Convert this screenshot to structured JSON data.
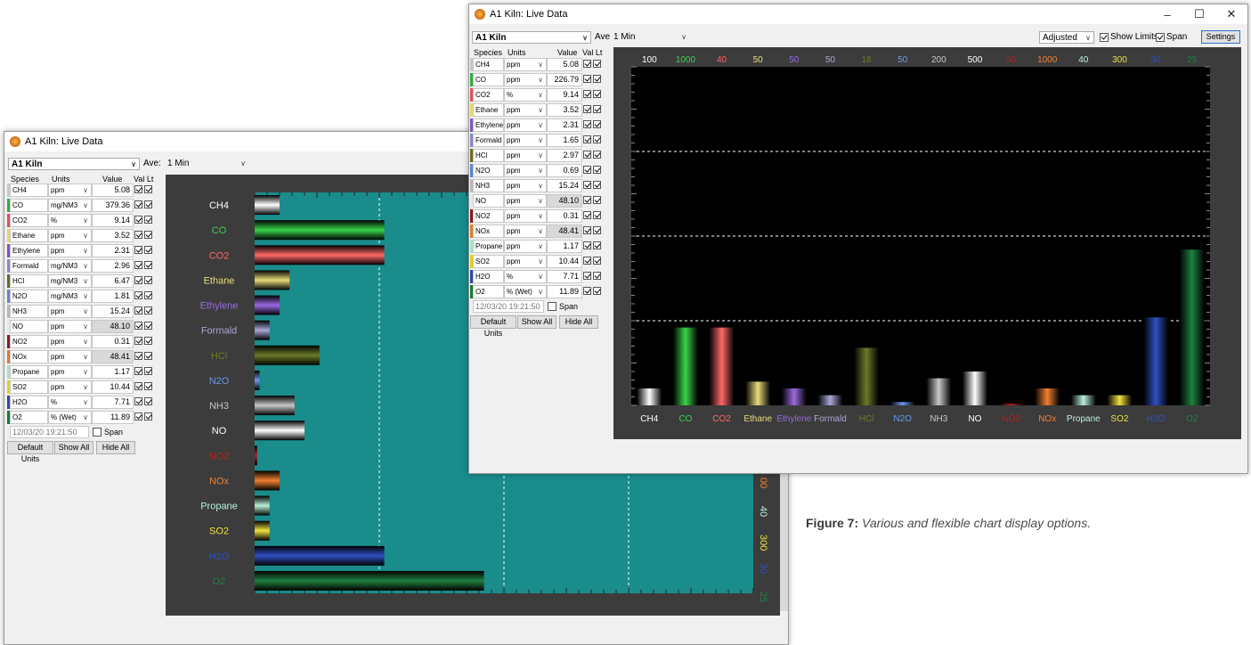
{
  "caption": {
    "label": "Figure 7:",
    "text": " Various and flexible chart display options."
  },
  "window_left": {
    "title": "A1 Kiln: Live Data",
    "kiln_select": "A1 Kiln",
    "ave_label": "Ave:",
    "ave_select": "1 Min",
    "headers": {
      "species": "Species",
      "units": "Units",
      "value": "Value",
      "val_lt": "Val Lt"
    },
    "rows": [
      {
        "name": "CH4",
        "unit": "ppm",
        "value": "5.08",
        "color": "#c8c8c8",
        "grey": false
      },
      {
        "name": "CO",
        "unit": "mg/NM3",
        "value": "379.36",
        "color": "#2fae3a",
        "grey": false
      },
      {
        "name": "CO2",
        "unit": "%",
        "value": "9.14",
        "color": "#e0505a",
        "grey": false
      },
      {
        "name": "Ethane",
        "unit": "ppm",
        "value": "3.52",
        "color": "#e6d86a",
        "grey": false
      },
      {
        "name": "Ethylene",
        "unit": "ppm",
        "value": "2.31",
        "color": "#7a55c0",
        "grey": false
      },
      {
        "name": "Formald",
        "unit": "mg/NM3",
        "value": "2.96",
        "color": "#8a88c8",
        "grey": false
      },
      {
        "name": "HCl",
        "unit": "mg/NM3",
        "value": "6.47",
        "color": "#6a6a20",
        "grey": false
      },
      {
        "name": "N2O",
        "unit": "mg/NM3",
        "value": "1.81",
        "color": "#5a86d0",
        "grey": false
      },
      {
        "name": "NH3",
        "unit": "ppm",
        "value": "15.24",
        "color": "#b8b8b8",
        "grey": false
      },
      {
        "name": "NO",
        "unit": "ppm",
        "value": "48.10",
        "color": "#e8e8e8",
        "grey": true
      },
      {
        "name": "NO2",
        "unit": "ppm",
        "value": "0.31",
        "color": "#8a1a1a",
        "grey": false
      },
      {
        "name": "NOx",
        "unit": "ppm",
        "value": "48.41",
        "color": "#e07a28",
        "grey": true
      },
      {
        "name": "Propane",
        "unit": "ppm",
        "value": "1.17",
        "color": "#a8e0c8",
        "grey": false
      },
      {
        "name": "SO2",
        "unit": "ppm",
        "value": "10.44",
        "color": "#e0d020",
        "grey": false
      },
      {
        "name": "H2O",
        "unit": "%",
        "value": "7.71",
        "color": "#2a4aa0",
        "grey": false
      },
      {
        "name": "O2",
        "unit": "% (Wet)",
        "value": "11.89",
        "color": "#1a7a30",
        "grey": false
      }
    ],
    "timestamp": "12/03/20 19:21:50",
    "span_label": "Span",
    "buttons": {
      "default_units": "Default Units",
      "show_all": "Show All",
      "hide_all": "Hide All"
    },
    "chart_data": {
      "type": "bar",
      "orientation": "horizontal",
      "background": "#1a8c8c",
      "categories": [
        "CH4",
        "CO",
        "CO2",
        "Ethane",
        "Ethylene",
        "Formald",
        "HCl",
        "N2O",
        "NH3",
        "NO",
        "NO2",
        "NOx",
        "Propane",
        "SO2",
        "H2O",
        "O2"
      ],
      "category_colors": [
        "#ffffff",
        "#3ad44a",
        "#ff6868",
        "#e8dc7a",
        "#9a6ae0",
        "#a8a8d8",
        "#6a7a28",
        "#6a9ae8",
        "#c8c8c8",
        "#ffffff",
        "#b82020",
        "#f08030",
        "#b8f0d8",
        "#f0e040",
        "#3050c0",
        "#208040"
      ],
      "values_percent_of_scale": [
        5,
        26,
        26,
        7,
        5,
        3,
        13,
        1,
        8,
        10,
        0.5,
        5,
        3,
        3,
        26,
        46
      ],
      "right_scale_labels_visible": [
        "00",
        "40",
        "300",
        "30",
        "25"
      ],
      "right_scale_colors": [
        "#f08030",
        "#b8f0d8",
        "#f0e040",
        "#3050c0",
        "#208040"
      ]
    }
  },
  "window_right": {
    "title": "A1 Kiln: Live Data",
    "kiln_select": "A1 Kiln",
    "ave_label": "Ave:",
    "ave_select": "1 Min",
    "adjusted_select": "Adjusted",
    "show_limits_label": "Show Limits",
    "span_label": "Span",
    "settings_label": "Settings",
    "win_min": "–",
    "win_max": "☐",
    "win_close": "✕",
    "headers": {
      "species": "Species",
      "units": "Units",
      "value": "Value",
      "val_lt": "Val Lt"
    },
    "rows": [
      {
        "name": "CH4",
        "unit": "ppm",
        "value": "5.08",
        "color": "#c8c8c8",
        "grey": false
      },
      {
        "name": "CO",
        "unit": "ppm",
        "value": "226.79",
        "color": "#2fae3a",
        "grey": false
      },
      {
        "name": "CO2",
        "unit": "%",
        "value": "9.14",
        "color": "#e0505a",
        "grey": false
      },
      {
        "name": "Ethane",
        "unit": "ppm",
        "value": "3.52",
        "color": "#e6d86a",
        "grey": false
      },
      {
        "name": "Ethylene",
        "unit": "ppm",
        "value": "2.31",
        "color": "#7a55c0",
        "grey": false
      },
      {
        "name": "Formald",
        "unit": "ppm",
        "value": "1.65",
        "color": "#8a88c8",
        "grey": false
      },
      {
        "name": "HCl",
        "unit": "ppm",
        "value": "2.97",
        "color": "#6a6a20",
        "grey": false
      },
      {
        "name": "N2O",
        "unit": "ppm",
        "value": "0.69",
        "color": "#5a86d0",
        "grey": false
      },
      {
        "name": "NH3",
        "unit": "ppm",
        "value": "15.24",
        "color": "#b8b8b8",
        "grey": false
      },
      {
        "name": "NO",
        "unit": "ppm",
        "value": "48.10",
        "color": "#e8e8e8",
        "grey": true
      },
      {
        "name": "NO2",
        "unit": "ppm",
        "value": "0.31",
        "color": "#8a1a1a",
        "grey": false
      },
      {
        "name": "NOx",
        "unit": "ppm",
        "value": "48.41",
        "color": "#e07a28",
        "grey": true
      },
      {
        "name": "Propane",
        "unit": "ppm",
        "value": "1.17",
        "color": "#a8e0c8",
        "grey": false
      },
      {
        "name": "SO2",
        "unit": "ppm",
        "value": "10.44",
        "color": "#e0d020",
        "grey": false
      },
      {
        "name": "H2O",
        "unit": "%",
        "value": "7.71",
        "color": "#2a4aa0",
        "grey": false
      },
      {
        "name": "O2",
        "unit": "% (Wet)",
        "value": "11.89",
        "color": "#1a7a30",
        "grey": false
      }
    ],
    "timestamp": "12/03/20 19:21:50",
    "span_label2": "Span",
    "buttons": {
      "default_units": "Default Units",
      "show_all": "Show All",
      "hide_all": "Hide All"
    },
    "chart_data": {
      "type": "bar",
      "orientation": "vertical",
      "background": "#000000",
      "categories": [
        "CH4",
        "CO",
        "CO2",
        "Ethane",
        "Ethylene",
        "Formald",
        "HCl",
        "N2O",
        "NH3",
        "NO",
        "NO2",
        "NOx",
        "Propane",
        "SO2",
        "H2O",
        "O2"
      ],
      "category_colors": [
        "#ffffff",
        "#3ad44a",
        "#ff6868",
        "#e8dc7a",
        "#9a6ae0",
        "#a8a8d8",
        "#6a7a28",
        "#6a9ae8",
        "#c8c8c8",
        "#ffffff",
        "#b82020",
        "#f08030",
        "#b8f0d8",
        "#f0e040",
        "#3050c0",
        "#208040"
      ],
      "scale_max_labels": [
        "100",
        "1000",
        "40",
        "50",
        "50",
        "50",
        "18",
        "50",
        "200",
        "500",
        "50",
        "1000",
        "40",
        "300",
        "30",
        "25"
      ],
      "values_percent_of_scale": [
        5,
        23,
        23,
        7,
        5,
        3,
        17,
        1,
        8,
        10,
        0.5,
        5,
        3,
        3,
        26,
        46
      ]
    }
  }
}
